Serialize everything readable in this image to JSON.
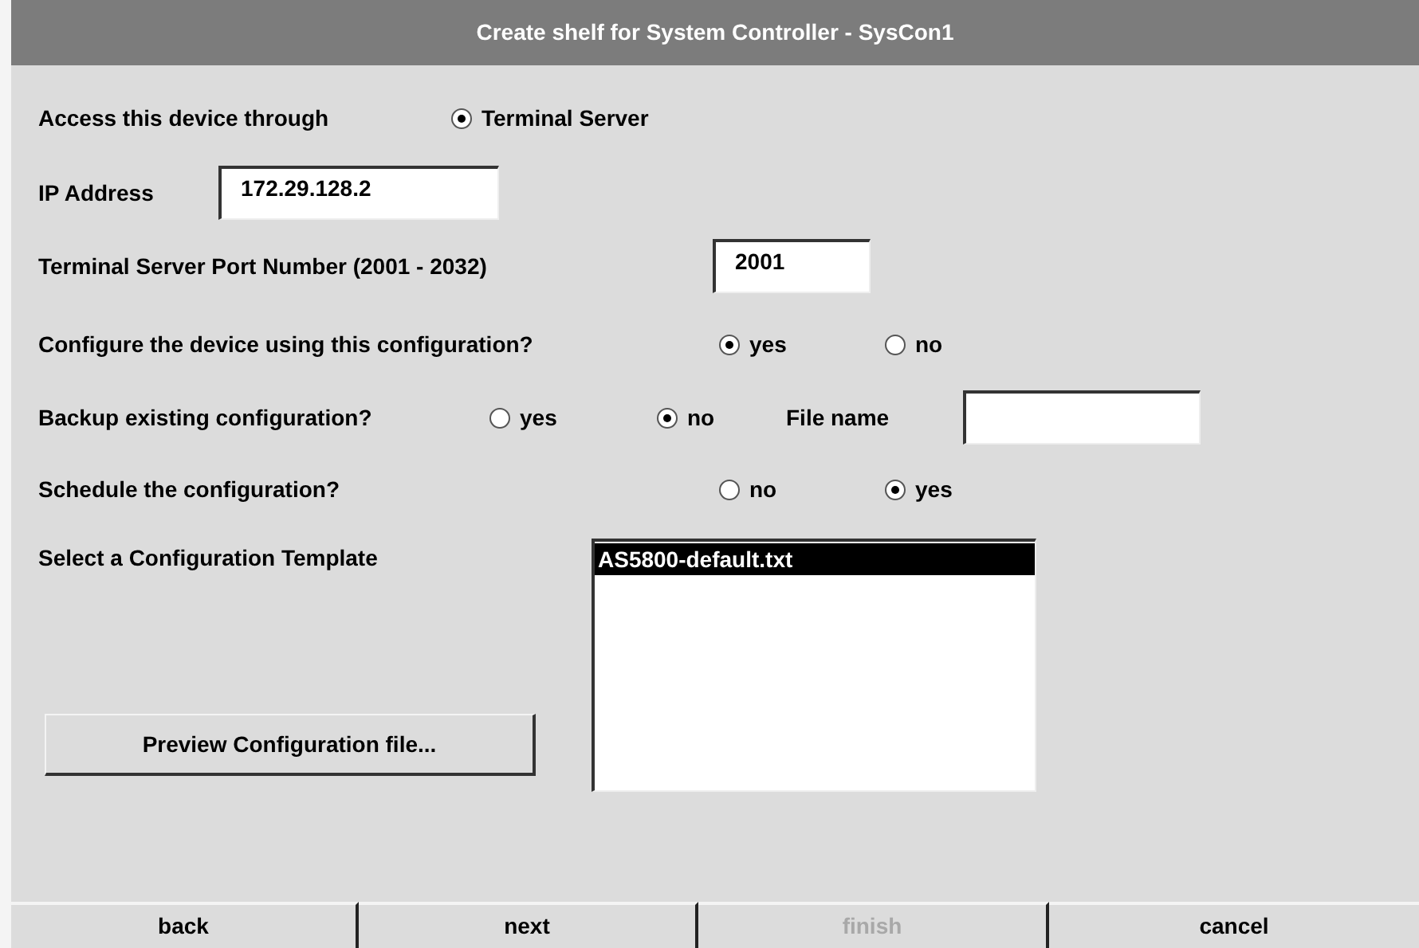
{
  "window": {
    "title": "Create shelf for System Controller - SysCon1"
  },
  "access": {
    "label": "Access this device through",
    "options": [
      {
        "label": "Terminal Server",
        "selected": true
      }
    ]
  },
  "ip_address": {
    "label": "IP Address",
    "value": "172.29.128.2"
  },
  "port": {
    "label": "Terminal Server Port Number (2001 - 2032)",
    "value": "2001"
  },
  "configure": {
    "label": "Configure the device using this configuration?",
    "options": [
      {
        "label": "yes",
        "selected": true
      },
      {
        "label": "no",
        "selected": false
      }
    ]
  },
  "backup": {
    "label": "Backup existing configuration?",
    "options": [
      {
        "label": "yes",
        "selected": false
      },
      {
        "label": "no",
        "selected": true
      }
    ],
    "file_name": {
      "label": "File name"
    }
  },
  "schedule": {
    "label": "Schedule the configuration?",
    "options": [
      {
        "label": "no",
        "selected": false
      },
      {
        "label": "yes",
        "selected": true
      }
    ]
  },
  "template": {
    "label": "Select a Configuration Template",
    "items": [
      {
        "label": "AS5800-default.txt",
        "selected": true
      }
    ]
  },
  "preview_button": "Preview Configuration file...",
  "buttons": [
    {
      "label": "back",
      "disabled": false
    },
    {
      "label": "next",
      "disabled": false
    },
    {
      "label": "finish",
      "disabled": true
    },
    {
      "label": "cancel",
      "disabled": false
    }
  ]
}
